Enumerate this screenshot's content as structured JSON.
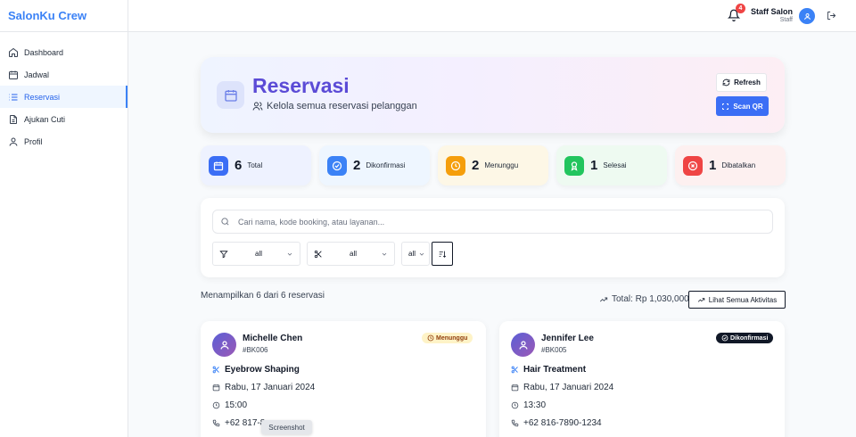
{
  "app": {
    "brand": "SalonKu Crew"
  },
  "sidebar": {
    "items": [
      {
        "label": "Dashboard",
        "icon": "home-icon",
        "active": false
      },
      {
        "label": "Jadwal",
        "icon": "calendar-icon",
        "active": false
      },
      {
        "label": "Reservasi",
        "icon": "list-icon",
        "active": true
      },
      {
        "label": "Ajukan Cuti",
        "icon": "document-icon",
        "active": false
      },
      {
        "label": "Profil",
        "icon": "user-icon",
        "active": false
      }
    ]
  },
  "topbar": {
    "notification_count": "4",
    "user_name": "Staff Salon",
    "user_role": "Staff"
  },
  "header": {
    "title": "Reservasi",
    "subtitle": "Kelola semua reservasi pelanggan",
    "refresh_label": "Refresh",
    "scan_label": "Scan QR"
  },
  "stats": [
    {
      "value": "6",
      "label": "Total",
      "color": "#3b6ef5",
      "bg": "#eef2ff",
      "icon": "calendar-icon"
    },
    {
      "value": "2",
      "label": "Dikonfirmasi",
      "color": "#3b82f6",
      "bg": "#eef6ff",
      "icon": "check-circle-icon"
    },
    {
      "value": "2",
      "label": "Menunggu",
      "color": "#f59e0b",
      "bg": "#fdf7e6",
      "icon": "clock-icon"
    },
    {
      "value": "1",
      "label": "Selesai",
      "color": "#22c55e",
      "bg": "#eefaf1",
      "icon": "award-icon"
    },
    {
      "value": "1",
      "label": "Dibatalkan",
      "color": "#ef4444",
      "bg": "#fdf0f0",
      "icon": "x-circle-icon"
    }
  ],
  "search": {
    "placeholder": "Cari nama, kode booking, atau layanan...",
    "status_filter": "all",
    "service_filter": "all",
    "third_filter": "all"
  },
  "summary": {
    "showing": "Menampilkan 6 dari 6 reservasi",
    "total": "Total: Rp 1,030,000",
    "activity_label": "Lihat Semua Aktivitas"
  },
  "reservations": [
    {
      "name": "Michelle Chen",
      "code": "#BK006",
      "status": "Menunggu",
      "service": "Eyebrow Shaping",
      "date": "Rabu, 17 Januari 2024",
      "time": "15:00",
      "phone": "+62 817-8"
    },
    {
      "name": "Jennifer Lee",
      "code": "#BK005",
      "status": "Dikonfirmasi",
      "service": "Hair Treatment",
      "date": "Rabu, 17 Januari 2024",
      "time": "13:30",
      "phone": "+62 816-7890-1234"
    }
  ],
  "tooltip": "Screenshot"
}
